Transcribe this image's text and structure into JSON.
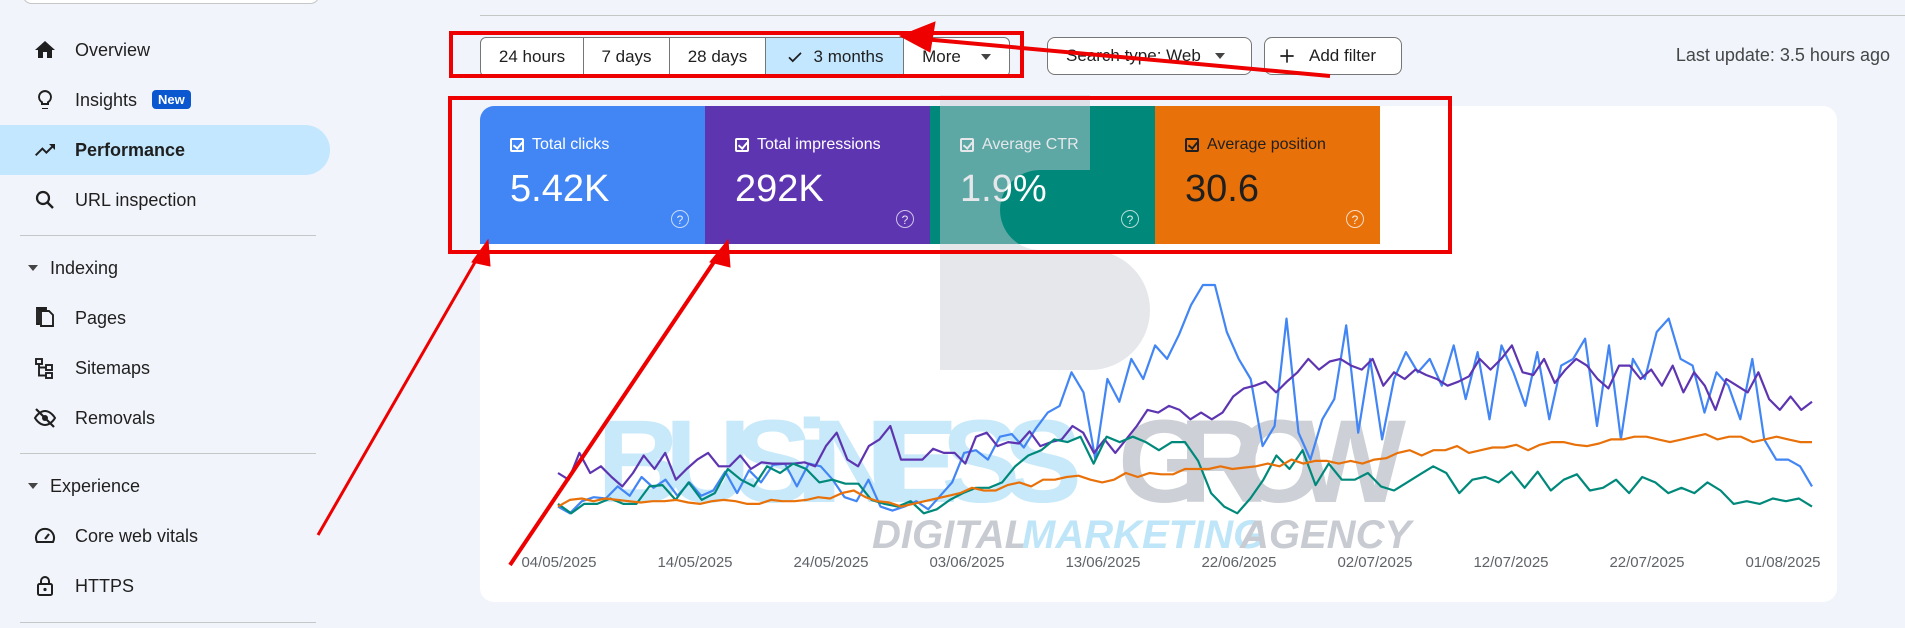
{
  "sidebar": {
    "items": [
      {
        "label": "Overview",
        "icon": "home-icon"
      },
      {
        "label": "Insights",
        "icon": "lightbulb-icon",
        "badge": "New"
      },
      {
        "label": "Performance",
        "icon": "trending-up-icon"
      },
      {
        "label": "URL inspection",
        "icon": "search-icon"
      }
    ],
    "sections": [
      {
        "label": "Indexing",
        "items": [
          {
            "label": "Pages",
            "icon": "pages-icon"
          },
          {
            "label": "Sitemaps",
            "icon": "sitemap-icon"
          },
          {
            "label": "Removals",
            "icon": "eye-off-icon"
          }
        ]
      },
      {
        "label": "Experience",
        "items": [
          {
            "label": "Core web vitals",
            "icon": "gauge-icon"
          },
          {
            "label": "HTTPS",
            "icon": "lock-icon"
          }
        ]
      }
    ]
  },
  "toolbar": {
    "ranges": [
      "24 hours",
      "7 days",
      "28 days",
      "3 months",
      "More"
    ],
    "selected": "3 months",
    "search_type": "Search type: Web",
    "add_filter": "Add filter",
    "last_update": "Last update: 3.5 hours ago"
  },
  "metrics": [
    {
      "label": "Total clicks",
      "value": "5.42K",
      "color": "#4285f4"
    },
    {
      "label": "Total impressions",
      "value": "292K",
      "color": "#5e35b1"
    },
    {
      "label": "Average CTR",
      "value": "1.9%",
      "color": "#00897b"
    },
    {
      "label": "Average position",
      "value": "30.6",
      "color": "#e8710a"
    }
  ],
  "watermark": {
    "line1": "BUSiNESS",
    "line2": "GROW",
    "line3a": "DIGITAL",
    "line3b": "MARKETING",
    "line3c": "AGENCY"
  },
  "chart_data": {
    "type": "line",
    "x_tick_labels": [
      "04/05/2025",
      "14/05/2025",
      "24/05/2025",
      "03/06/2025",
      "13/06/2025",
      "22/06/2025",
      "02/07/2025",
      "12/07/2025",
      "22/07/2025",
      "01/08/2025"
    ],
    "grid": false,
    "series": [
      {
        "name": "Total clicks",
        "color": "#4285f4",
        "values": [
          10,
          5,
          14,
          17,
          16,
          25,
          18,
          32,
          24,
          30,
          18,
          28,
          18,
          22,
          36,
          20,
          37,
          28,
          41,
          42,
          25,
          42,
          40,
          30,
          17,
          14,
          30,
          10,
          7,
          10,
          14,
          8,
          18,
          28,
          50,
          52,
          45,
          62,
          64,
          54,
          68,
          80,
          85,
          110,
          95,
          45,
          105,
          88,
          120,
          105,
          130,
          120,
          138,
          160,
          175,
          175,
          140,
          120,
          105,
          55,
          70,
          150,
          65,
          45,
          75,
          90,
          145,
          65,
          120,
          60,
          105,
          125,
          110,
          120,
          100,
          130,
          90,
          125,
          75,
          130,
          110,
          85,
          125,
          75,
          115,
          120,
          135,
          70,
          130,
          60,
          120,
          105,
          140,
          150,
          120,
          115,
          80,
          110,
          100,
          75,
          120,
          60,
          45,
          45,
          40,
          25
        ]
      },
      {
        "name": "Total impressions",
        "color": "#5e35b1",
        "values": [
          35,
          30,
          50,
          35,
          40,
          32,
          25,
          35,
          48,
          38,
          50,
          30,
          38,
          45,
          50,
          40,
          40,
          48,
          38,
          43,
          42,
          42,
          42,
          43,
          40,
          55,
          65,
          45,
          40,
          55,
          60,
          70,
          45,
          45,
          45,
          53,
          50,
          50,
          42,
          62,
          65,
          55,
          58,
          57,
          66,
          55,
          58,
          60,
          70,
          65,
          50,
          60,
          50,
          60,
          70,
          82,
          80,
          85,
          82,
          75,
          80,
          75,
          80,
          92,
          98,
          100,
          103,
          95,
          103,
          110,
          120,
          112,
          118,
          120,
          115,
          112,
          120,
          100,
          110,
          105,
          112,
          108,
          105,
          100,
          103,
          107,
          120,
          112,
          120,
          130,
          110,
          108,
          120,
          102,
          112,
          120,
          115,
          105,
          98,
          115,
          115,
          105,
          112,
          100,
          115,
          95,
          110,
          100,
          82,
          105,
          100,
          95,
          110,
          90,
          82,
          92,
          82,
          88
        ]
      },
      {
        "name": "Average CTR",
        "color": "#00897b",
        "values": [
          12,
          5,
          12,
          12,
          16,
          12,
          12,
          25,
          26,
          15,
          28,
          15,
          20,
          38,
          30,
          25,
          40,
          35,
          42,
          38,
          28,
          30,
          27,
          27,
          15,
          12,
          10,
          14,
          5,
          8,
          15,
          20,
          24,
          24,
          28,
          40,
          48,
          52,
          60,
          58,
          62,
          42,
          62,
          58,
          62,
          58,
          52,
          58,
          58,
          44,
          20,
          10,
          5,
          16,
          30,
          48,
          38,
          52,
          26,
          42,
          30,
          30,
          35,
          25,
          22,
          28,
          34,
          40,
          35,
          20,
          30,
          32,
          28,
          36,
          24,
          36,
          22,
          30,
          34,
          22,
          24,
          30,
          20,
          32,
          28,
          20,
          24,
          20,
          28,
          22,
          12,
          14,
          12,
          16,
          14,
          16,
          10
        ]
      },
      {
        "name": "Average position",
        "color": "#e8710a",
        "values": [
          10,
          15,
          16,
          14,
          16,
          15,
          14,
          13,
          14,
          14,
          15,
          13,
          12,
          14,
          15,
          14,
          12,
          12,
          15,
          14,
          14,
          15,
          17,
          16,
          20,
          22,
          17,
          14,
          13,
          10,
          12,
          14,
          16,
          18,
          20,
          24,
          22,
          22,
          26,
          28,
          25,
          30,
          30,
          32,
          33,
          30,
          28,
          30,
          35,
          32,
          35,
          34,
          34,
          38,
          38,
          38,
          40,
          38,
          39,
          40,
          42,
          40,
          45,
          42,
          44,
          44,
          42,
          44,
          42,
          45,
          46,
          50,
          52,
          48,
          52,
          52,
          55,
          50,
          52,
          54,
          54,
          56,
          52,
          56,
          58,
          58,
          56,
          55,
          57,
          60,
          60,
          62,
          62,
          60,
          58,
          60,
          62,
          64,
          60,
          62,
          62,
          58,
          60,
          62,
          60,
          58,
          58
        ]
      }
    ]
  }
}
